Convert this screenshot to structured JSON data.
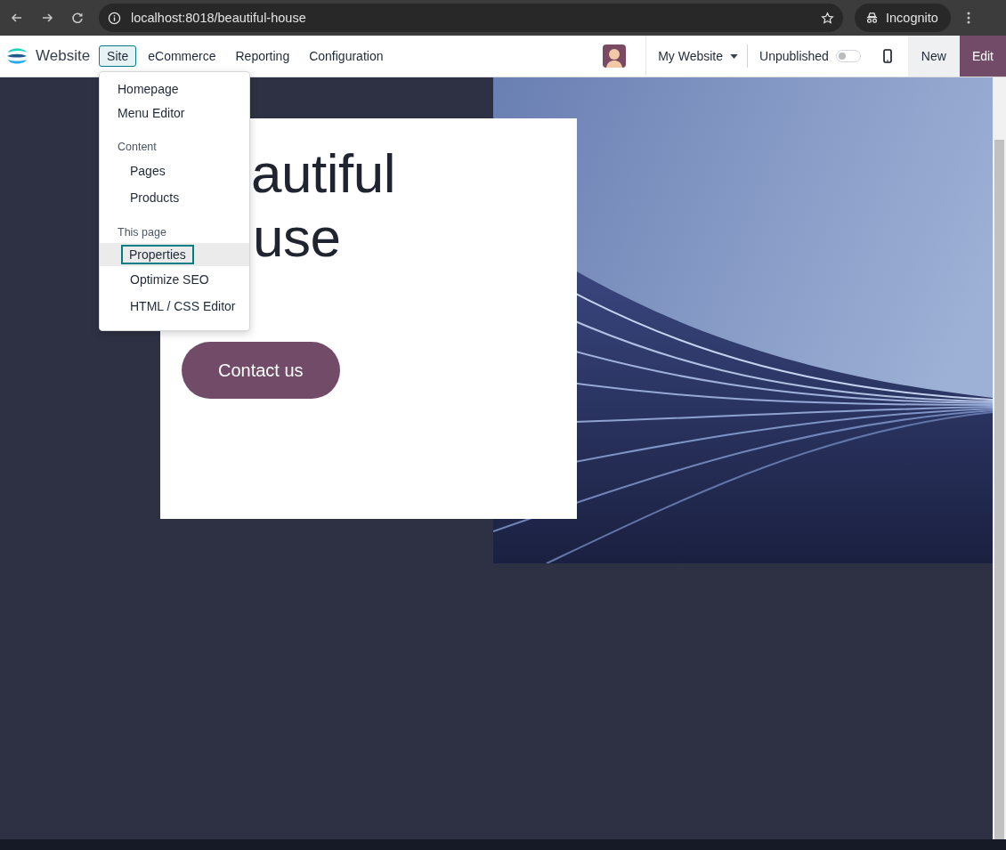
{
  "browser": {
    "url": "localhost:8018/beautiful-house",
    "profile": "Incognito"
  },
  "navbar": {
    "app_name": "Website",
    "menus": [
      {
        "label": "Site",
        "selected": true
      },
      {
        "label": "eCommerce",
        "selected": false
      },
      {
        "label": "Reporting",
        "selected": false
      },
      {
        "label": "Configuration",
        "selected": false
      }
    ],
    "website_switcher": "My Website",
    "publish": {
      "label": "Unpublished",
      "on": false
    },
    "new_button": "New",
    "edit_button": "Edit"
  },
  "site_menu": {
    "items": [
      {
        "label": "Homepage",
        "selected": false
      },
      {
        "label": "Menu Editor",
        "selected": false
      }
    ],
    "sections": [
      {
        "header": "Content",
        "items": [
          {
            "label": "Pages",
            "selected": false
          },
          {
            "label": "Products",
            "selected": false
          }
        ]
      },
      {
        "header": "This page",
        "items": [
          {
            "label": "Properties",
            "selected": true
          },
          {
            "label": "Optimize SEO",
            "selected": false
          },
          {
            "label": "HTML / CSS Editor",
            "selected": false
          }
        ]
      }
    ]
  },
  "hero": {
    "heading_lines": [
      "autiful",
      "use"
    ],
    "button": "Contact us",
    "image": {
      "kind": "picture"
    }
  }
}
